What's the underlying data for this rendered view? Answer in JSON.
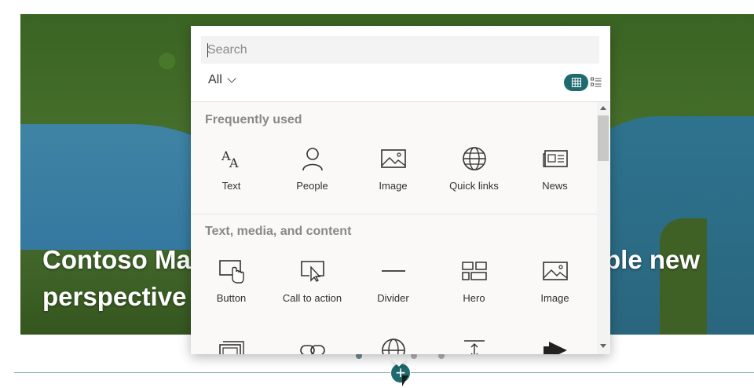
{
  "hero": {
    "title_line1_left": "Contoso Ma",
    "title_line1_right": "ble new",
    "title_line2": "perspective"
  },
  "toolbox": {
    "search_placeholder": "Search",
    "filter_label": "All",
    "groups": [
      {
        "title": "Frequently used",
        "items": [
          {
            "label": "Text",
            "icon": "text-icon"
          },
          {
            "label": "People",
            "icon": "people-icon"
          },
          {
            "label": "Image",
            "icon": "image-icon"
          },
          {
            "label": "Quick links",
            "icon": "globe-icon"
          },
          {
            "label": "News",
            "icon": "news-icon"
          }
        ]
      },
      {
        "title": "Text, media, and content",
        "items": [
          {
            "label": "Button",
            "icon": "button-icon"
          },
          {
            "label": "Call to action",
            "icon": "call-to-action-icon"
          },
          {
            "label": "Divider",
            "icon": "divider-icon"
          },
          {
            "label": "Hero",
            "icon": "hero-icon"
          },
          {
            "label": "Image",
            "icon": "image-icon"
          }
        ]
      }
    ],
    "partial_row_icons": [
      "image-gallery-icon",
      "link-icon",
      "globe-icon",
      "spacer-icon",
      "stream-icon"
    ]
  },
  "colors": {
    "accent": "#1e6a6e",
    "group_title": "#8a8886",
    "tile_label": "#323130"
  }
}
